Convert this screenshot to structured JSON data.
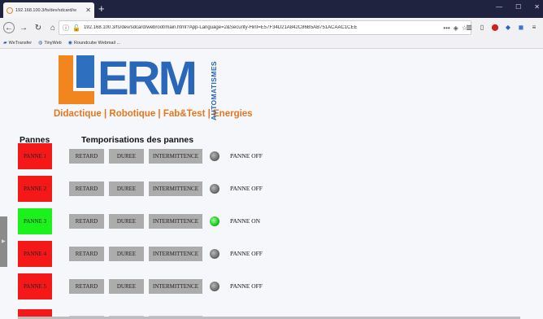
{
  "browser": {
    "tab_title": "192.168.100.3/fs/dev/sdcard/w",
    "url": "192.168.100.3/fs/dev/sdcard/webroot/main.html?App-Language=2&Security-Hint=E57F34D21A842C86B5AB751ACAAC1CEE",
    "bookmarks": [
      {
        "label": "WeTransfer",
        "icon": "wetransfer-icon"
      },
      {
        "label": "TinyWeb",
        "icon": "globe-icon"
      },
      {
        "label": "Roundcube Webmail ...",
        "icon": "roundcube-icon"
      }
    ]
  },
  "logo": {
    "name": "ERM",
    "tagline": "Didactique | Robotique | Fab&Test | Energies",
    "vertical": "AUTOMATISMES"
  },
  "headers": {
    "pannes": "Pannes",
    "temporisations": "Temporisations des pannes"
  },
  "buttons": {
    "retard": "RETARD",
    "duree": "DUREE",
    "intermittence": "INTERMITTENCE"
  },
  "rows": [
    {
      "label": "PANNE 1",
      "state": "off",
      "status": "PANNE OFF"
    },
    {
      "label": "PANNE 2",
      "state": "off",
      "status": "PANNE OFF"
    },
    {
      "label": "PANNE 3",
      "state": "on",
      "status": "PANNE ON"
    },
    {
      "label": "PANNE 4",
      "state": "off",
      "status": "PANNE OFF"
    },
    {
      "label": "PANNE 5",
      "state": "off",
      "status": "PANNE OFF"
    }
  ],
  "colors": {
    "panne_off": "#f51818",
    "panne_on": "#1bf11b",
    "button": "#acacac",
    "brand_blue": "#2a67b8",
    "brand_orange": "#f2861e"
  }
}
